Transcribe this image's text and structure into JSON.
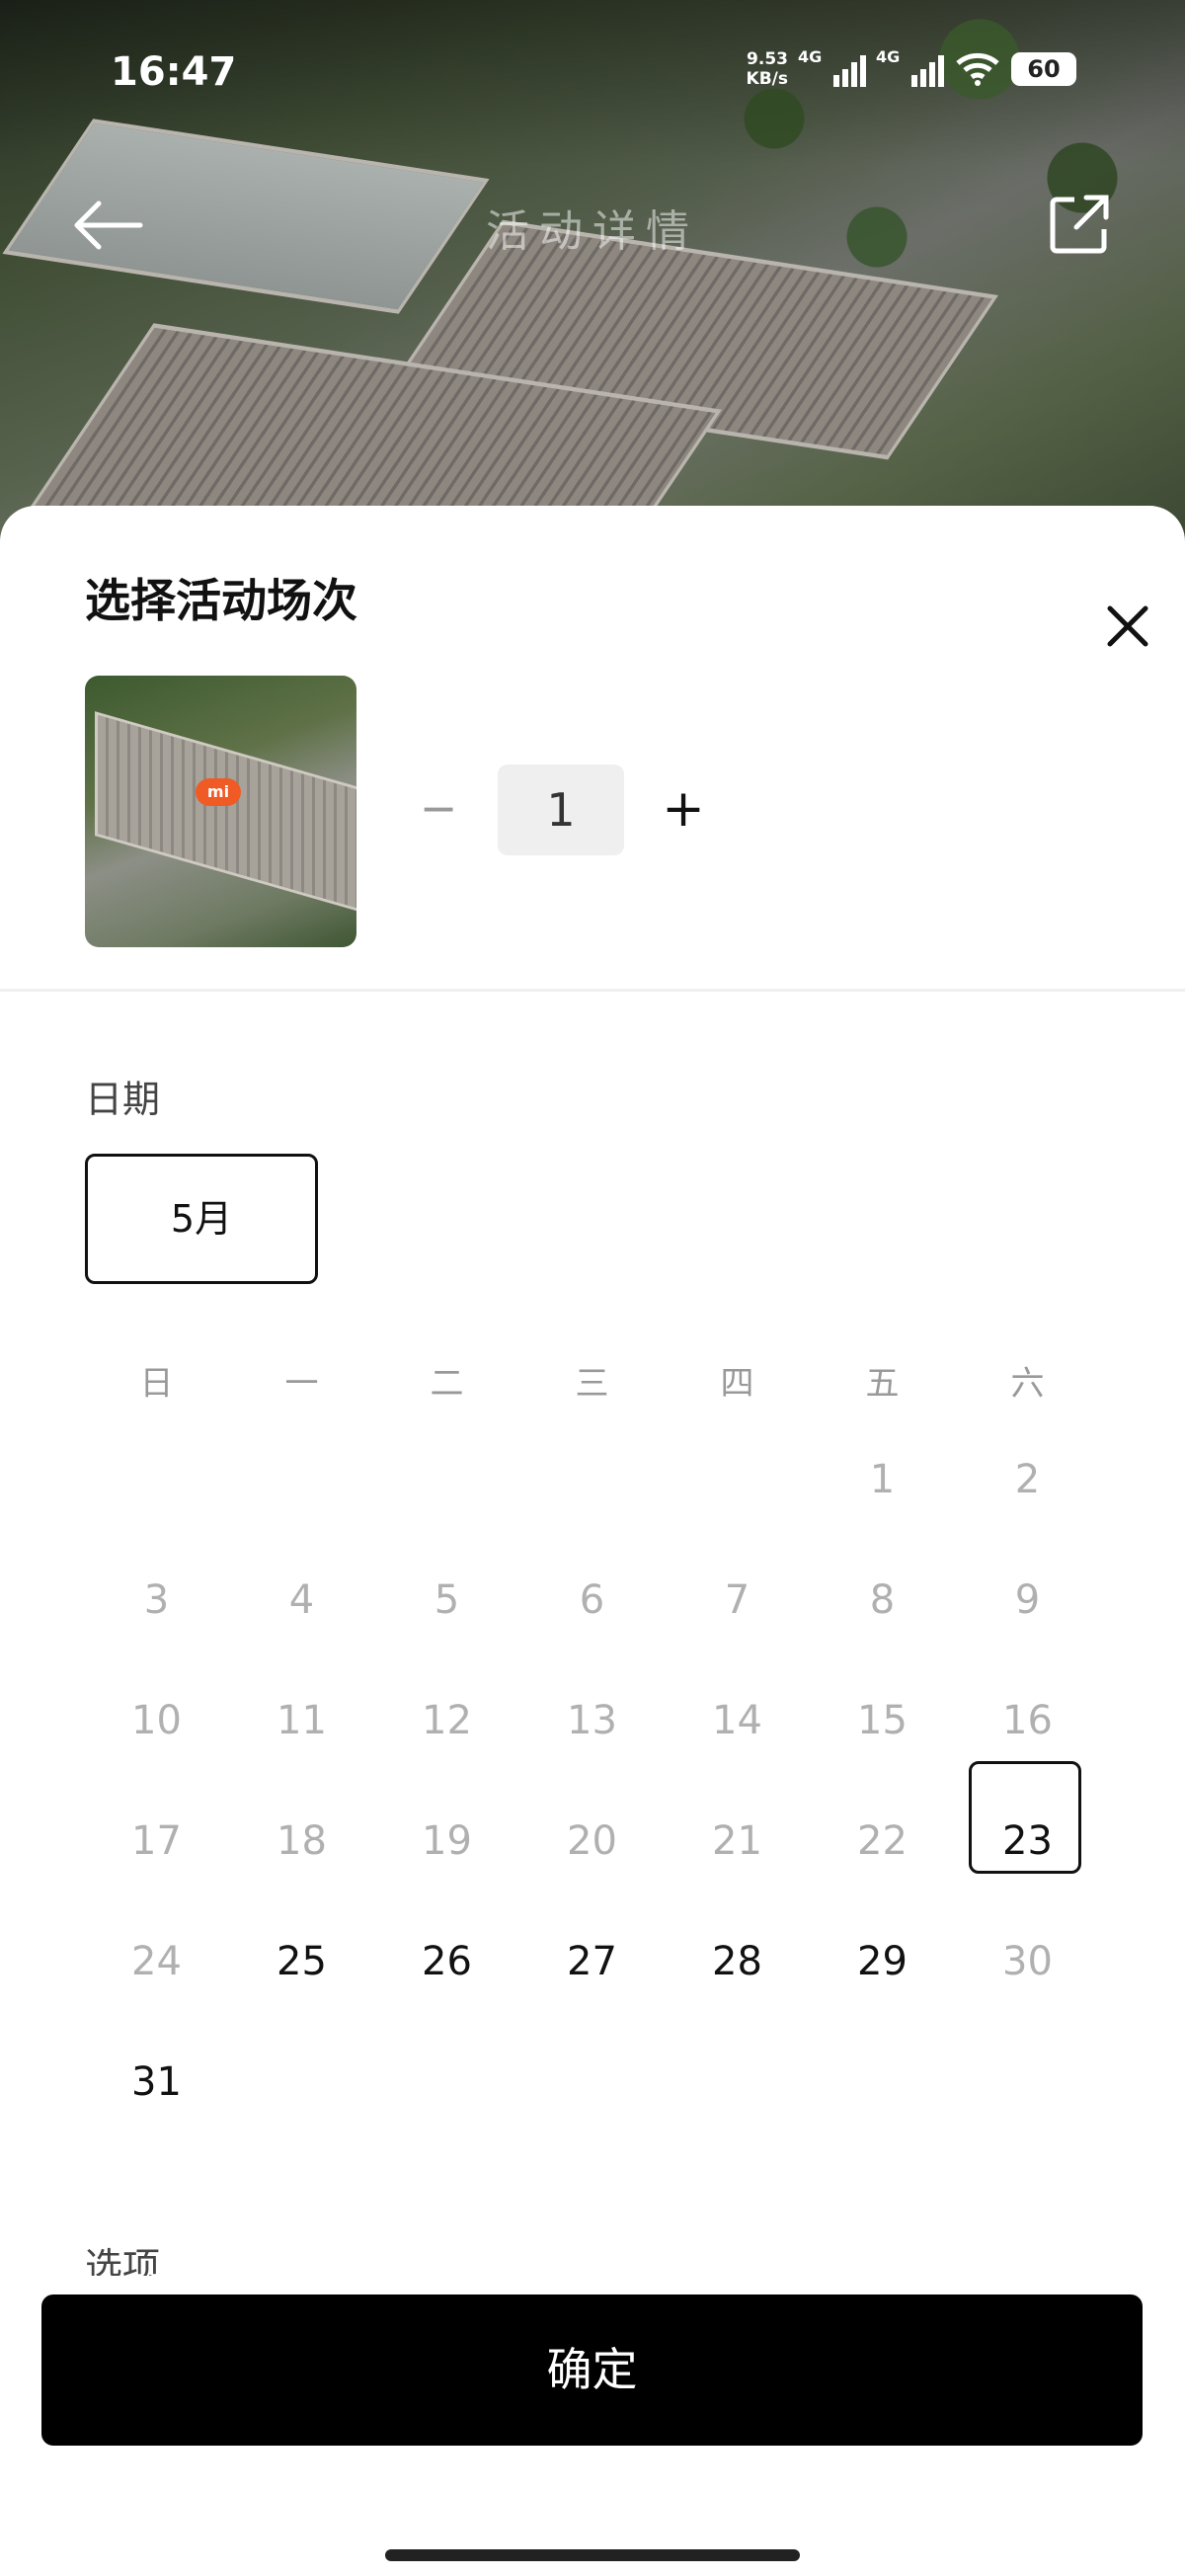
{
  "status_bar": {
    "time": "16:47",
    "net_speed_value": "9.53",
    "net_speed_unit": "KB/s",
    "signal1_label": "4G",
    "signal2_label": "4G",
    "battery": "60"
  },
  "nav": {
    "title": "活动详情",
    "back_icon": "arrow-left-icon",
    "share_icon": "share-icon"
  },
  "sheet": {
    "title": "选择活动场次",
    "quantity": {
      "minus": "−",
      "value": "1",
      "plus": "+"
    },
    "date_label": "日期",
    "month_chip": "5月",
    "options_label": "选项",
    "confirm": "确定"
  },
  "calendar": {
    "weekdays": [
      "日",
      "一",
      "二",
      "三",
      "四",
      "五",
      "六"
    ],
    "weeks": [
      [
        null,
        null,
        null,
        null,
        null,
        "1",
        "2"
      ],
      [
        "3",
        "4",
        "5",
        "6",
        "7",
        "8",
        "9"
      ],
      [
        "10",
        "11",
        "12",
        "13",
        "14",
        "15",
        "16"
      ],
      [
        "17",
        "18",
        "19",
        "20",
        "21",
        "22",
        "23"
      ],
      [
        "24",
        "25",
        "26",
        "27",
        "28",
        "29",
        "30"
      ],
      [
        "31",
        null,
        null,
        null,
        null,
        null,
        null
      ]
    ],
    "available_days": [
      "23",
      "25",
      "26",
      "27",
      "28",
      "29",
      "31"
    ],
    "selected_day": "23"
  },
  "colors": {
    "accent": "#000000",
    "disabled_text": "#b0b0b0",
    "sheet_bg": "#ffffff"
  }
}
